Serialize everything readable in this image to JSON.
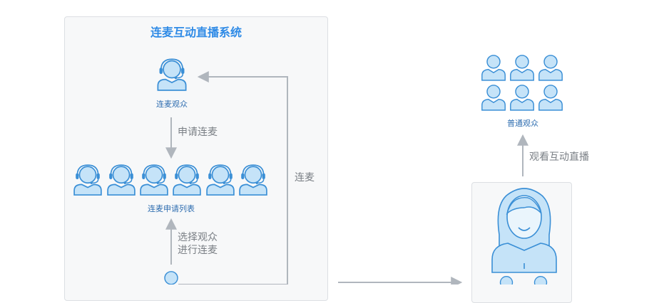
{
  "system": {
    "title": "连麦互动直播系统",
    "connected_viewer_label": "连麦观众",
    "apply_label": "申请连麦",
    "apply_list_label": "连麦申请列表",
    "select_line1": "选择观众",
    "select_line2": "进行连麦",
    "connect_label": "连麦"
  },
  "viewers": {
    "label": "普通观众",
    "watch_label": "观看互动直播"
  },
  "colors": {
    "icon_fill": "#c5e3f8",
    "icon_stroke": "#3a8fd6",
    "arrow": "#b0b6bd"
  }
}
